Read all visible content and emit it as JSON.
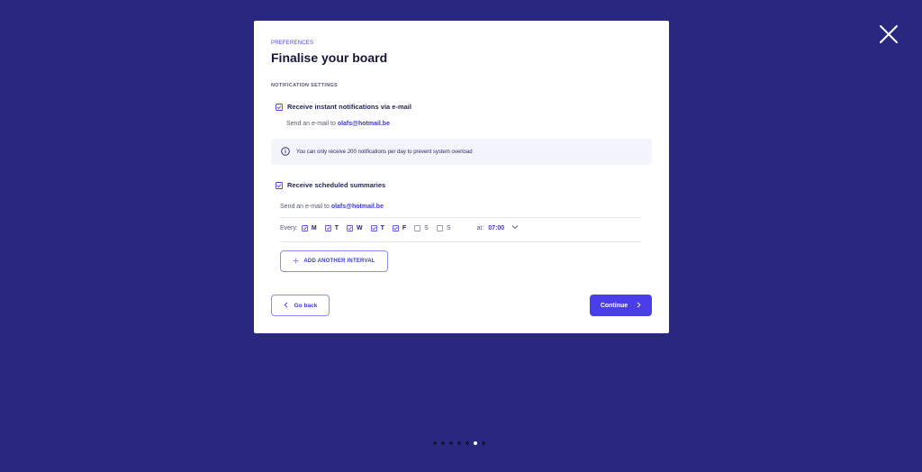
{
  "close": {
    "icon": "close-icon"
  },
  "modal": {
    "eyebrow": "PREFERENCES",
    "title": "Finalise your board",
    "section_label": "NOTIFICATION SETTINGS",
    "instant": {
      "checked": true,
      "label": "Receive instant notifications via e-mail",
      "send_prefix": "Send an e-mail to ",
      "email": "olafs@hotmail.be"
    },
    "info": {
      "icon": "info-icon",
      "text": "You can only receive 200 notifications per day to prevent system overload"
    },
    "scheduled": {
      "checked": true,
      "label": "Receive scheduled summaries",
      "send_prefix": "Send an e-mail to ",
      "email": "olafs@hotmail.be",
      "every_label": "Every:",
      "days": [
        {
          "label": "M",
          "checked": true
        },
        {
          "label": "T",
          "checked": true
        },
        {
          "label": "W",
          "checked": true
        },
        {
          "label": "T",
          "checked": true
        },
        {
          "label": "F",
          "checked": true
        },
        {
          "label": "S",
          "checked": false
        },
        {
          "label": "S",
          "checked": false
        }
      ],
      "at_label": "at:",
      "time": "07:00"
    },
    "add_interval_label": "ADD ANOTHER INTERVAL",
    "back_label": "Go back",
    "continue_label": "Continue"
  },
  "pager": {
    "total": 7,
    "active_index": 5
  },
  "colors": {
    "background": "#2a2781",
    "accent": "#4a3ee9",
    "link": "#3e38d4",
    "text_dark": "#161637"
  }
}
